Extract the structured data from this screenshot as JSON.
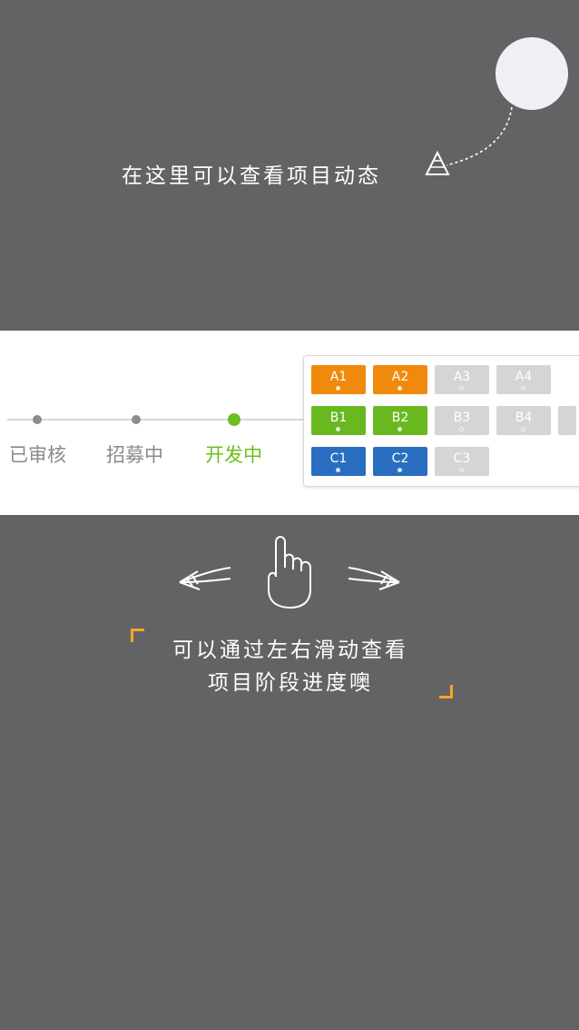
{
  "top_hint": {
    "text": "在这里可以查看项目动态"
  },
  "stages": [
    {
      "label": "已审核",
      "active": false
    },
    {
      "label": "招募中",
      "active": false
    },
    {
      "label": "开发中",
      "active": true
    }
  ],
  "phase_grid": {
    "rows": [
      [
        {
          "label": "A1",
          "state": "done"
        },
        {
          "label": "A2",
          "state": "done"
        },
        {
          "label": "A3",
          "state": "pending"
        },
        {
          "label": "A4",
          "state": "pending"
        }
      ],
      [
        {
          "label": "B1",
          "state": "done"
        },
        {
          "label": "B2",
          "state": "done"
        },
        {
          "label": "B3",
          "state": "pending"
        },
        {
          "label": "B4",
          "state": "pending"
        }
      ],
      [
        {
          "label": "C1",
          "state": "done"
        },
        {
          "label": "C2",
          "state": "done"
        },
        {
          "label": "C3",
          "state": "pending"
        }
      ]
    ],
    "row_colors": [
      "#f08a0c",
      "#6ab820",
      "#2a6ec1"
    ],
    "pending_color": "#d5d5d5"
  },
  "bottom_hint": {
    "line1": "可以通过左右滑动查看",
    "line2": "项目阶段进度噢"
  },
  "colors": {
    "overlay": "#636366",
    "active_stage": "#6cbf1e",
    "bracket": "#f5a623"
  },
  "icons": [
    "avatar-placeholder",
    "dashed-arrow-icon",
    "swipe-left-arrow-icon",
    "hand-pointer-icon",
    "swipe-right-arrow-icon"
  ]
}
